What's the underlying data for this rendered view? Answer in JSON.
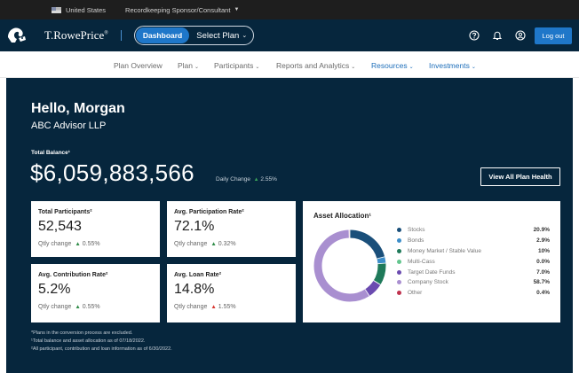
{
  "topbar": {
    "country": "United States",
    "role": "Recordkeeping Sponsor/Consultant"
  },
  "header": {
    "brand": "T.RowePrice",
    "brand_mark": "®",
    "dashboard_label": "Dashboard",
    "select_plan_label": "Select Plan",
    "logout_label": "Log out"
  },
  "nav": {
    "items": [
      {
        "label": "Plan Overview",
        "dropdown": false,
        "active": false
      },
      {
        "label": "Plan",
        "dropdown": true,
        "active": false
      },
      {
        "label": "Participants",
        "dropdown": true,
        "active": false
      },
      {
        "label": "Reports and Analytics",
        "dropdown": true,
        "active": false
      },
      {
        "label": "Resources",
        "dropdown": true,
        "active": true
      },
      {
        "label": "Investments",
        "dropdown": true,
        "active": true
      }
    ]
  },
  "greeting": {
    "hello": "Hello, Morgan",
    "company": "ABC Advisor LLP"
  },
  "balance": {
    "label": "Total Balance¹",
    "value": "$6,059,883,566",
    "daily_change_label": "Daily Change",
    "daily_change_value": "2.55%",
    "view_button": "View All Plan Health"
  },
  "cards": [
    {
      "title": "Total Participants²",
      "value": "52,543",
      "change_label": "Qtly change",
      "change_value": "0.55%",
      "direction": "up"
    },
    {
      "title": "Avg. Participation Rate²",
      "value": "72.1%",
      "change_label": "Qtly change",
      "change_value": "0.32%",
      "direction": "up"
    },
    {
      "title": "Avg. Contribution Rate²",
      "value": "5.2%",
      "change_label": "Qtly change",
      "change_value": "0.55%",
      "direction": "up"
    },
    {
      "title": "Avg. Loan Rate²",
      "value": "14.8%",
      "change_label": "Qtly change",
      "change_value": "1.55%",
      "direction": "down"
    }
  ],
  "asset_allocation": {
    "title": "Asset Allocation¹",
    "items": [
      {
        "label": "Stocks",
        "value": "20.9%",
        "pct": 20.9,
        "color": "#1a4f7a"
      },
      {
        "label": "Bonds",
        "value": "2.9%",
        "pct": 2.9,
        "color": "#3d8ec9"
      },
      {
        "label": "Money Market / Stable Value",
        "value": "10%",
        "pct": 10,
        "color": "#1f7a5a"
      },
      {
        "label": "Multi-Cass",
        "value": "0.0%",
        "pct": 0.0,
        "color": "#63c58e"
      },
      {
        "label": "Target Date Funds",
        "value": "7.0%",
        "pct": 7.0,
        "color": "#6b4bb0"
      },
      {
        "label": "Company Stock",
        "value": "58.7%",
        "pct": 58.7,
        "color": "#a98fd0"
      },
      {
        "label": "Other",
        "value": "0.4%",
        "pct": 0.4,
        "color": "#c0324e"
      }
    ]
  },
  "footnotes": [
    "*Plans in the conversion process are excluded.",
    "¹Total balance and asset allocation as of 07/18/2022.",
    "²All participant, contribution and loan information as of 6/30/2022."
  ]
}
